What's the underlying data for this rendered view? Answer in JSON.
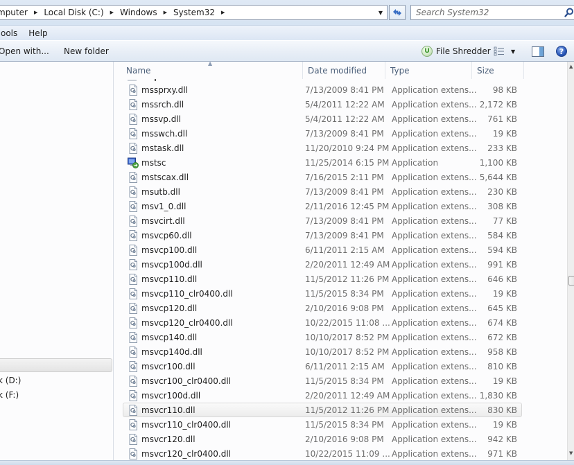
{
  "address_bar": {
    "breadcrumbs": [
      "mputer",
      "Local Disk (C:)",
      "Windows",
      "System32"
    ],
    "search_placeholder": "Search System32"
  },
  "menu": [
    "ools",
    "Help"
  ],
  "command_bar": {
    "open_with": "Open with...",
    "new_folder": "New folder",
    "file_shredder": "File Shredder",
    "shredder_icon_letter": "U",
    "help_glyph": "?"
  },
  "nav_pane": {
    "items": [
      {
        "label": "",
        "selected": true
      },
      {
        "label": "k (D:)",
        "selected": false
      },
      {
        "label": "k (F:)",
        "selected": false
      }
    ]
  },
  "file_list": {
    "columns": {
      "name": "Name",
      "date": "Date modified",
      "type": "Type",
      "size": "Size"
    },
    "sorted_by": "Name",
    "rows": [
      {
        "name": "mssprxy.dll",
        "date": "7/13/2009 8:41 PM",
        "type": "Application extens...",
        "size": "98 KB",
        "icon": "dll"
      },
      {
        "name": "mssrch.dll",
        "date": "5/4/2011 12:22 AM",
        "type": "Application extens...",
        "size": "2,172 KB",
        "icon": "dll"
      },
      {
        "name": "mssvp.dll",
        "date": "5/4/2011 12:22 AM",
        "type": "Application extens...",
        "size": "761 KB",
        "icon": "dll"
      },
      {
        "name": "msswch.dll",
        "date": "7/13/2009 8:41 PM",
        "type": "Application extens...",
        "size": "19 KB",
        "icon": "dll"
      },
      {
        "name": "mstask.dll",
        "date": "11/20/2010 9:24 PM",
        "type": "Application extens...",
        "size": "233 KB",
        "icon": "dll"
      },
      {
        "name": "mstsc",
        "date": "11/25/2014 6:15 PM",
        "type": "Application",
        "size": "1,100 KB",
        "icon": "app"
      },
      {
        "name": "mstscax.dll",
        "date": "7/16/2015 2:11 PM",
        "type": "Application extens...",
        "size": "5,644 KB",
        "icon": "dll"
      },
      {
        "name": "msutb.dll",
        "date": "7/13/2009 8:41 PM",
        "type": "Application extens...",
        "size": "230 KB",
        "icon": "dll"
      },
      {
        "name": "msv1_0.dll",
        "date": "2/11/2016 12:45 PM",
        "type": "Application extens...",
        "size": "308 KB",
        "icon": "dll"
      },
      {
        "name": "msvcirt.dll",
        "date": "7/13/2009 8:41 PM",
        "type": "Application extens...",
        "size": "77 KB",
        "icon": "dll"
      },
      {
        "name": "msvcp60.dll",
        "date": "7/13/2009 8:41 PM",
        "type": "Application extens...",
        "size": "584 KB",
        "icon": "dll"
      },
      {
        "name": "msvcp100.dll",
        "date": "6/11/2011 2:15 AM",
        "type": "Application extens...",
        "size": "594 KB",
        "icon": "dll"
      },
      {
        "name": "msvcp100d.dll",
        "date": "2/20/2011 12:49 AM",
        "type": "Application extens...",
        "size": "991 KB",
        "icon": "dll"
      },
      {
        "name": "msvcp110.dll",
        "date": "11/5/2012 11:26 PM",
        "type": "Application extens...",
        "size": "646 KB",
        "icon": "dll"
      },
      {
        "name": "msvcp110_clr0400.dll",
        "date": "11/5/2015 8:34 PM",
        "type": "Application extens...",
        "size": "19 KB",
        "icon": "dll"
      },
      {
        "name": "msvcp120.dll",
        "date": "2/10/2016 9:08 PM",
        "type": "Application extens...",
        "size": "645 KB",
        "icon": "dll"
      },
      {
        "name": "msvcp120_clr0400.dll",
        "date": "10/22/2015 11:08 ...",
        "type": "Application extens...",
        "size": "674 KB",
        "icon": "dll"
      },
      {
        "name": "msvcp140.dll",
        "date": "10/10/2017 8:52 PM",
        "type": "Application extens...",
        "size": "672 KB",
        "icon": "dll"
      },
      {
        "name": "msvcp140d.dll",
        "date": "10/10/2017 8:52 PM",
        "type": "Application extens...",
        "size": "958 KB",
        "icon": "dll"
      },
      {
        "name": "msvcr100.dll",
        "date": "6/11/2011 2:15 AM",
        "type": "Application extens...",
        "size": "810 KB",
        "icon": "dll"
      },
      {
        "name": "msvcr100_clr0400.dll",
        "date": "11/5/2015 8:34 PM",
        "type": "Application extens...",
        "size": "19 KB",
        "icon": "dll"
      },
      {
        "name": "msvcr100d.dll",
        "date": "2/20/2011 12:49 AM",
        "type": "Application extens...",
        "size": "1,830 KB",
        "icon": "dll"
      },
      {
        "name": "msvcr110.dll",
        "date": "11/5/2012 11:26 PM",
        "type": "Application extens...",
        "size": "830 KB",
        "icon": "dll",
        "hover": true
      },
      {
        "name": "msvcr110_clr0400.dll",
        "date": "11/5/2015 8:34 PM",
        "type": "Application extens...",
        "size": "19 KB",
        "icon": "dll"
      },
      {
        "name": "msvcr120.dll",
        "date": "2/10/2016 9:08 PM",
        "type": "Application extens...",
        "size": "942 KB",
        "icon": "dll"
      },
      {
        "name": "msvcr120_clr0400.dll",
        "date": "10/22/2015 11:09 ...",
        "type": "Application extens...",
        "size": "971 KB",
        "icon": "dll"
      }
    ]
  },
  "scrollbar": {
    "position_fraction": 0.55
  },
  "colors": {
    "header_text": "#4c607a",
    "secondary_text": "#6d6d6d",
    "chrome_blue": "#dce6f4"
  }
}
